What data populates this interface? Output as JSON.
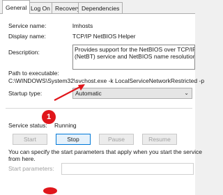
{
  "tabs": [
    "General",
    "Log On",
    "Recovery",
    "Dependencies"
  ],
  "fields": {
    "service_name_label": "Service name:",
    "service_name_value": "lmhosts",
    "display_name_label": "Display name:",
    "display_name_value": "TCP/IP NetBIOS Helper",
    "description_label": "Description:",
    "description_lines": [
      "Provides support for the NetBIOS over TCP/IP",
      "(NetBT) service and NetBIOS name resolution for"
    ],
    "path_label": "Path to executable:",
    "path_value": "C:\\WINDOWS\\System32\\svchost.exe -k LocalServiceNetworkRestricted -p",
    "startup_label": "Startup type:",
    "startup_value": "Automatic",
    "status_label": "Service status:",
    "status_value": "Running"
  },
  "buttons": {
    "start": "Start",
    "stop": "Stop",
    "pause": "Pause",
    "resume": "Resume"
  },
  "hint_lines": [
    "You can specify the start parameters that apply when you start the service",
    "from here."
  ],
  "start_params_label": "Start parameters:",
  "annotations": {
    "badge_1": "1"
  },
  "colors": {
    "annotation_red": "#e0161b",
    "selected_tab": "#ffffff"
  }
}
